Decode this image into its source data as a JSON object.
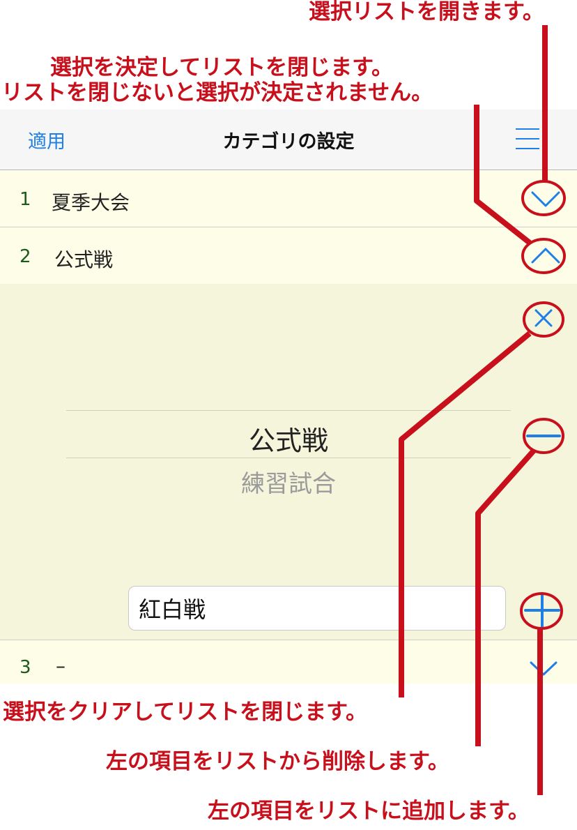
{
  "annotations": {
    "open_list": "選択リストを開きます。",
    "decide_line1": "選択を決定してリストを閉じます。",
    "decide_line2": "リストを閉じないと選択が決定されません。",
    "clear": "選択をクリアしてリストを閉じます。",
    "delete": "左の項目をリストから削除します。",
    "add": "左の項目をリストに追加します。"
  },
  "navbar": {
    "apply_label": "適用",
    "title": "カテゴリの設定",
    "menu_icon": "hamburger-icon"
  },
  "rows": [
    {
      "number": "1",
      "label": "夏季大会",
      "icon": "chevron-down-icon"
    },
    {
      "number": "2",
      "label": "公式戦",
      "icon": "chevron-up-icon"
    },
    {
      "number": "3",
      "label": "–",
      "icon": "chevron-down-icon"
    }
  ],
  "picker": {
    "selected": "公式戦",
    "next": "練習試合"
  },
  "input": {
    "value": "紅白戦"
  },
  "colors": {
    "accent": "#1e7fe4",
    "annotation": "#c8101c",
    "row_background": "#fdfde8",
    "panel_background": "#f5f5dc",
    "row_number": "#1a5a1a"
  }
}
